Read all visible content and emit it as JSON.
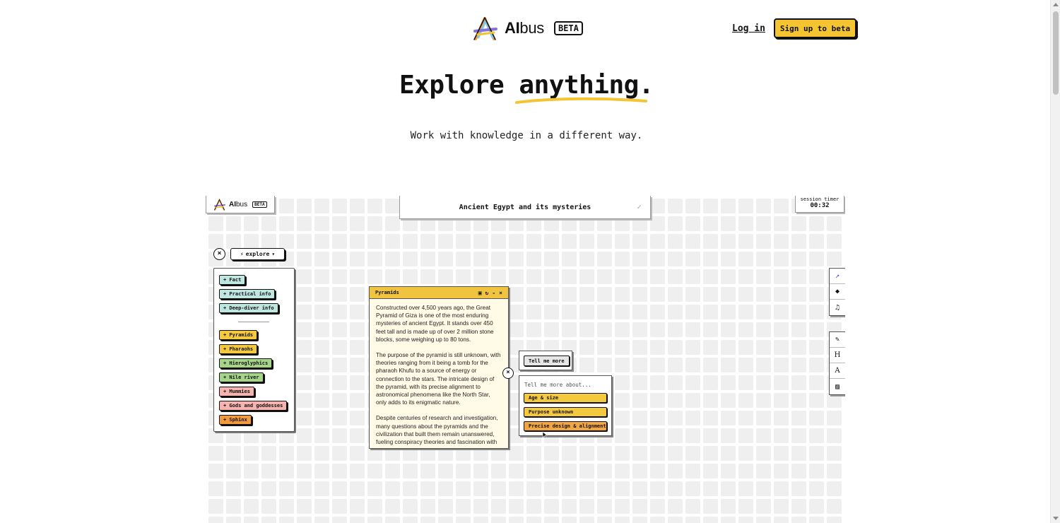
{
  "header": {
    "brand_prefix": "AI",
    "brand_suffix": "bus",
    "beta": "BETA",
    "login": "Log in",
    "signup": "Sign up to beta"
  },
  "hero": {
    "title_plain": "Explore",
    "title_highlight": "anything.",
    "subtitle": "Work with knowledge in a different way.",
    "accent_color": "#f5c431"
  },
  "demo": {
    "mini_brand_prefix": "AI",
    "mini_brand_suffix": "bus",
    "mini_beta": "BETA",
    "topic": "Ancient Egypt and its mysteries",
    "timer_label": "session timer",
    "timer_value": "00:32",
    "explore_label": "explore",
    "chips_top": [
      "+ Fact",
      "+ Practical info",
      "+ Deep-diver info"
    ],
    "chips_topics": [
      "+ Pyramids",
      "+ Pharaohs",
      "+ Hieroglyphics",
      "+ Nile river",
      "+ Mummies",
      "+ Gods and goddesses",
      "+ Sphinx"
    ],
    "card": {
      "title": "Pyramids",
      "paragraphs": [
        "Constructed over 4,500 years ago, the Great Pyramid of Giza is one of the most enduring mysteries of ancient Egypt. It stands over 450 feet tall and is made up of over 2 million stone blocks, some weighing up to 80 tons.",
        "The purpose of the pyramid is still unknown, with theories ranging from it being a tomb for the pharaoh Khufu to a source of energy or connection to the stars. The intricate design of the pyramid, with its precise alignment to astronomical phenomena like the North Star, only adds to its enigmatic nature.",
        "Despite centuries of research and investigation, many questions about the pyramids and the civilization that built them remain unanswered, fueling conspiracy theories and fascination with"
      ]
    },
    "tell_me_more": "Tell me more",
    "tell_more_label": "Tell me more about...",
    "tell_more_options": [
      "Age & size",
      "Purpose unknown",
      "Precise design & alignment"
    ]
  }
}
